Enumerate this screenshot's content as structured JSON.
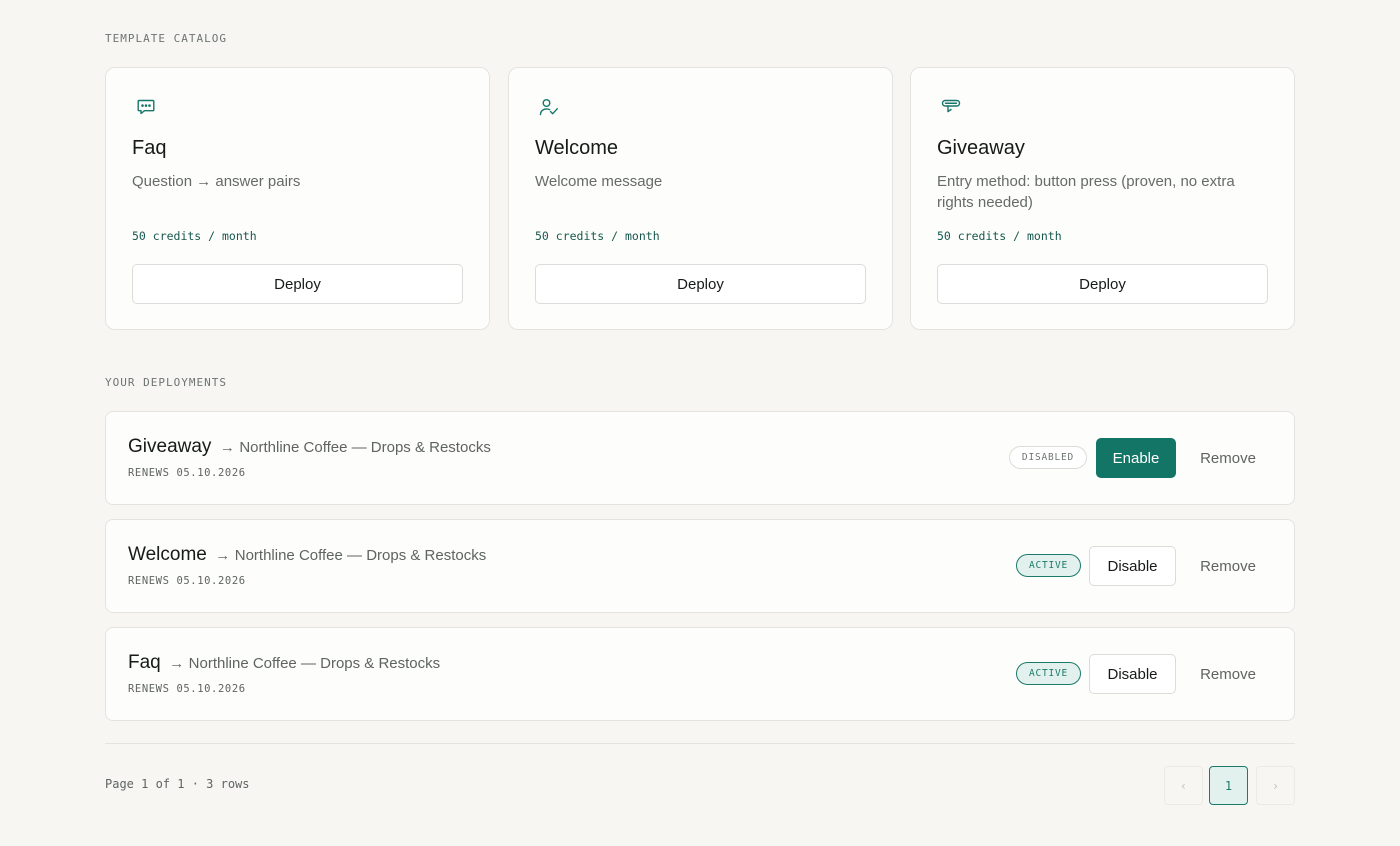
{
  "catalog": {
    "section_title": "TEMPLATE CATALOG",
    "cards": [
      {
        "icon": "chat-bubble-icon",
        "name": "Faq",
        "description": "Question → answer pairs",
        "price": "50 credits / month",
        "deploy_label": "Deploy"
      },
      {
        "icon": "user-check-icon",
        "name": "Welcome",
        "description": "Welcome message",
        "price": "50 credits / month",
        "deploy_label": "Deploy"
      },
      {
        "icon": "gift-icon",
        "name": "Giveaway",
        "description": "Entry method: button press (proven, no extra rights needed)",
        "price": "50 credits / month",
        "deploy_label": "Deploy"
      }
    ]
  },
  "deployments": {
    "section_title": "YOUR DEPLOYMENTS",
    "rows": [
      {
        "name": "Giveaway",
        "arrow": "→",
        "target": "Northline Coffee — Drops & Restocks",
        "renews": "RENEWS 05.10.2026",
        "status": "DISABLED",
        "action_label": "Enable",
        "remove_label": "Remove"
      },
      {
        "name": "Welcome",
        "arrow": "→",
        "target": "Northline Coffee — Drops & Restocks",
        "renews": "RENEWS 05.10.2026",
        "status": "ACTIVE",
        "action_label": "Disable",
        "remove_label": "Remove"
      },
      {
        "name": "Faq",
        "arrow": "→",
        "target": "Northline Coffee — Drops & Restocks",
        "renews": "RENEWS 05.10.2026",
        "status": "ACTIVE",
        "action_label": "Disable",
        "remove_label": "Remove"
      }
    ]
  },
  "pagination": {
    "info": "Page 1 of 1 · 3 rows",
    "prev_label": "‹",
    "current_page": "1",
    "next_label": "›"
  },
  "colors": {
    "accent": "#137566",
    "background": "#f7f6f3",
    "card": "#fdfdfb",
    "active_badge_bg": "#e3f1ee"
  }
}
